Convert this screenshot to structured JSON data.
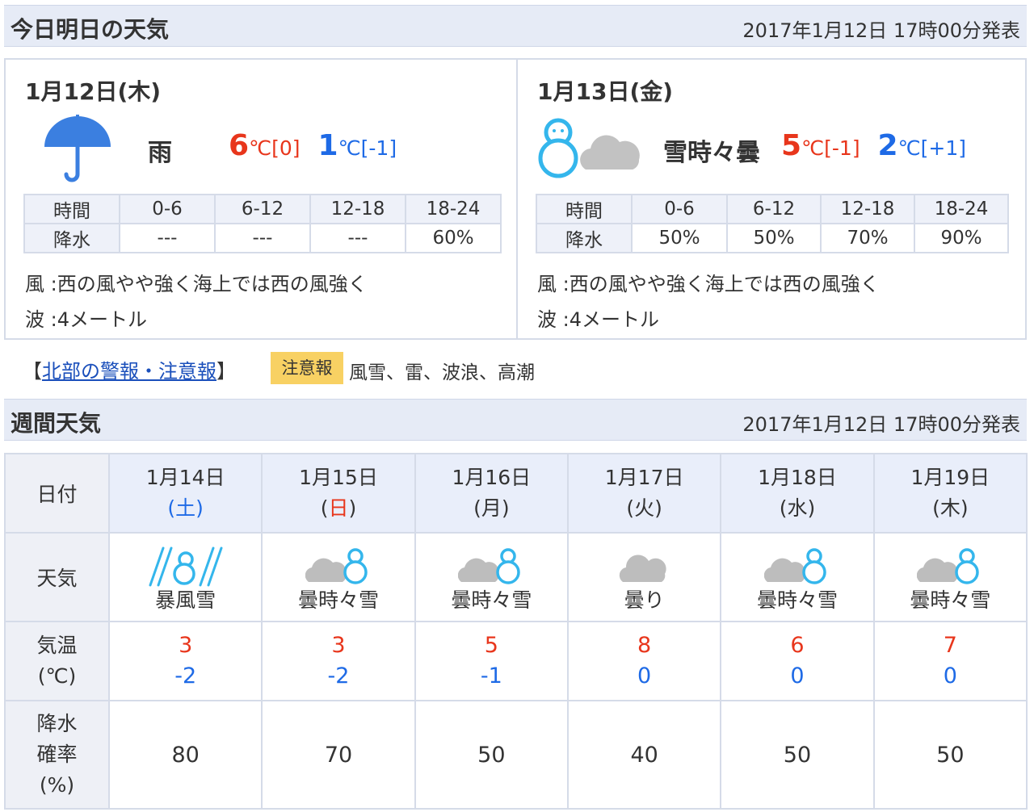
{
  "today_header": {
    "title": "今日明日の天気",
    "issued": "2017年1月12日 17時00分発表"
  },
  "days": [
    {
      "date": "1月12日(木)",
      "weather": "雨",
      "icon": "umbrella-rain-icon",
      "high": "6",
      "high_diff": "[0]",
      "low": "1",
      "low_diff": "[-1]",
      "unit": "℃",
      "precip_headers": [
        "時間",
        "0-6",
        "6-12",
        "12-18",
        "18-24"
      ],
      "precip_label": "降水",
      "precip_values": [
        "---",
        "---",
        "---",
        "60%"
      ],
      "wind": "風 :西の風やや強く海上では西の風強く",
      "wave": "波 :4メートル"
    },
    {
      "date": "1月13日(金)",
      "weather": "雪時々曇",
      "icon": "snowman-cloud-icon",
      "high": "5",
      "high_diff": "[-1]",
      "low": "2",
      "low_diff": "[+1]",
      "unit": "℃",
      "precip_headers": [
        "時間",
        "0-6",
        "6-12",
        "12-18",
        "18-24"
      ],
      "precip_label": "降水",
      "precip_values": [
        "50%",
        "50%",
        "70%",
        "90%"
      ],
      "wind": "風 :西の風やや強く海上では西の風強く",
      "wave": "波 :4メートル"
    }
  ],
  "warning": {
    "bracket_open": "【",
    "link": "北部の警報・注意報",
    "bracket_close": "】",
    "badge": "注意報",
    "items": "風雪、雷、波浪、高潮"
  },
  "week_header": {
    "title": "週間天気",
    "issued": "2017年1月12日 17時00分発表"
  },
  "week": {
    "row_labels": {
      "date": "日付",
      "weather": "天気",
      "temp": [
        "気温",
        "(℃)"
      ],
      "precip": [
        "降水",
        "確率",
        "(%)"
      ]
    },
    "days": [
      {
        "date": "1月14日",
        "dow": "(土)",
        "dow_color": "sat",
        "icon": "snowstorm-icon",
        "weather": "暴風雪",
        "high": "3",
        "low": "-2",
        "pop": "80"
      },
      {
        "date": "1月15日",
        "dow": "(日)",
        "dow_color": "sun",
        "icon": "cloud-snowman-icon",
        "weather": "曇時々雪",
        "high": "3",
        "low": "-2",
        "pop": "70"
      },
      {
        "date": "1月16日",
        "dow": "(月)",
        "dow_color": "normal",
        "icon": "cloud-snowman-icon",
        "weather": "曇時々雪",
        "high": "5",
        "low": "-1",
        "pop": "50"
      },
      {
        "date": "1月17日",
        "dow": "(火)",
        "dow_color": "normal",
        "icon": "cloud-icon",
        "weather": "曇り",
        "high": "8",
        "low": "0",
        "pop": "40"
      },
      {
        "date": "1月18日",
        "dow": "(水)",
        "dow_color": "normal",
        "icon": "cloud-snowman-icon",
        "weather": "曇時々雪",
        "high": "6",
        "low": "0",
        "pop": "50"
      },
      {
        "date": "1月19日",
        "dow": "(木)",
        "dow_color": "normal",
        "icon": "cloud-snowman-icon",
        "weather": "曇時々雪",
        "high": "7",
        "low": "0",
        "pop": "50"
      }
    ]
  },
  "colors": {
    "header_bg": "#e6ebf6",
    "high_temp": "#e8361c",
    "low_temp": "#1e6ae6",
    "link": "#1a4fbb",
    "badge": "#f8d163",
    "icon_blue": "#3b7fe0",
    "cloud": "#c2c2c2",
    "snowman": "#34b6ec"
  }
}
